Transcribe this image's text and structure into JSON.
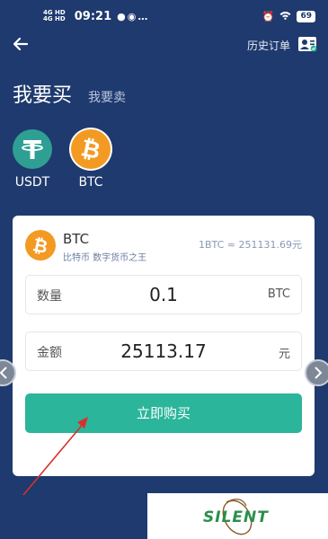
{
  "status_bar": {
    "net_top": "4G HD",
    "net_bottom": "4G HD",
    "time": "09:21",
    "battery": "69"
  },
  "header": {
    "history_label": "历史订单"
  },
  "tabs": {
    "buy": "我要买",
    "sell": "我要卖"
  },
  "coins": [
    {
      "label": "USDT",
      "icon": "tether-icon",
      "color": "#2f9f93"
    },
    {
      "label": "BTC",
      "icon": "bitcoin-icon",
      "color": "#f39a23",
      "selected": true
    }
  ],
  "card": {
    "coin_name": "BTC",
    "coin_subtitle": "比特币  数字货币之王",
    "rate": "1BTC ≈ 251131.69元",
    "quantity": {
      "label": "数量",
      "value": "0.1",
      "unit": "BTC"
    },
    "amount": {
      "label": "金额",
      "value": "25113.17",
      "unit": "元"
    },
    "buy_button": "立即购买"
  },
  "watermark": {
    "text": "SILENT"
  },
  "colors": {
    "background": "#1f3a6e",
    "accent": "#2bb59a",
    "bitcoin": "#f39a23",
    "tether": "#2f9f93",
    "annotation_arrow": "#d9302c"
  }
}
